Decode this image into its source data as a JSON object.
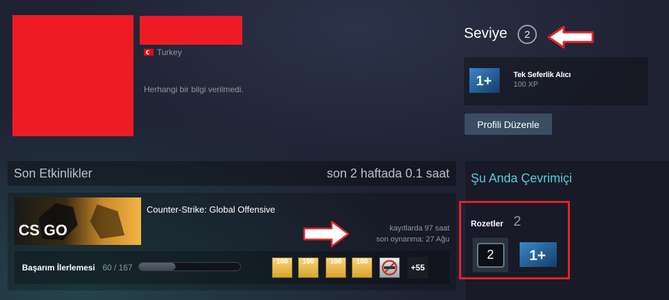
{
  "profile": {
    "country": "Turkey",
    "summary": "Herhangi bir bilgi verilmedi."
  },
  "level": {
    "label": "Seviye",
    "value": "2"
  },
  "badge_card": {
    "icon_text": "1+",
    "name": "Tek Seferlik Alıcı",
    "xp": "100 XP"
  },
  "edit_button": "Profili Düzenle",
  "recent_activity": {
    "title": "Son Etkinlikler",
    "hours": "son 2 haftada 0.1 saat",
    "game": {
      "logo_text": "CS GO",
      "name": "Counter-Strike: Global Offensive",
      "hours_on_record": "kayıtlarda 97 saat",
      "last_played": "son oynanma: 27 Ağu",
      "achievements_label": "Başarım İlerlemesi",
      "achievements_count": "60 / 167",
      "achievements_progress": 0.36,
      "achievement_icons": [
        "100",
        "100",
        "100",
        "100",
        ""
      ],
      "more": "+55"
    }
  },
  "right_column": {
    "online": "Şu Anda Çevrimiçi",
    "badges_label": "Rozetler",
    "badges_count": "2",
    "badge_level": "2",
    "badge_small_text": "1+"
  },
  "colors": {
    "redaction": "#ed1c24",
    "accent_link": "#57cbde",
    "button": "#3a4d63",
    "highlight_box": "#e5222a"
  }
}
